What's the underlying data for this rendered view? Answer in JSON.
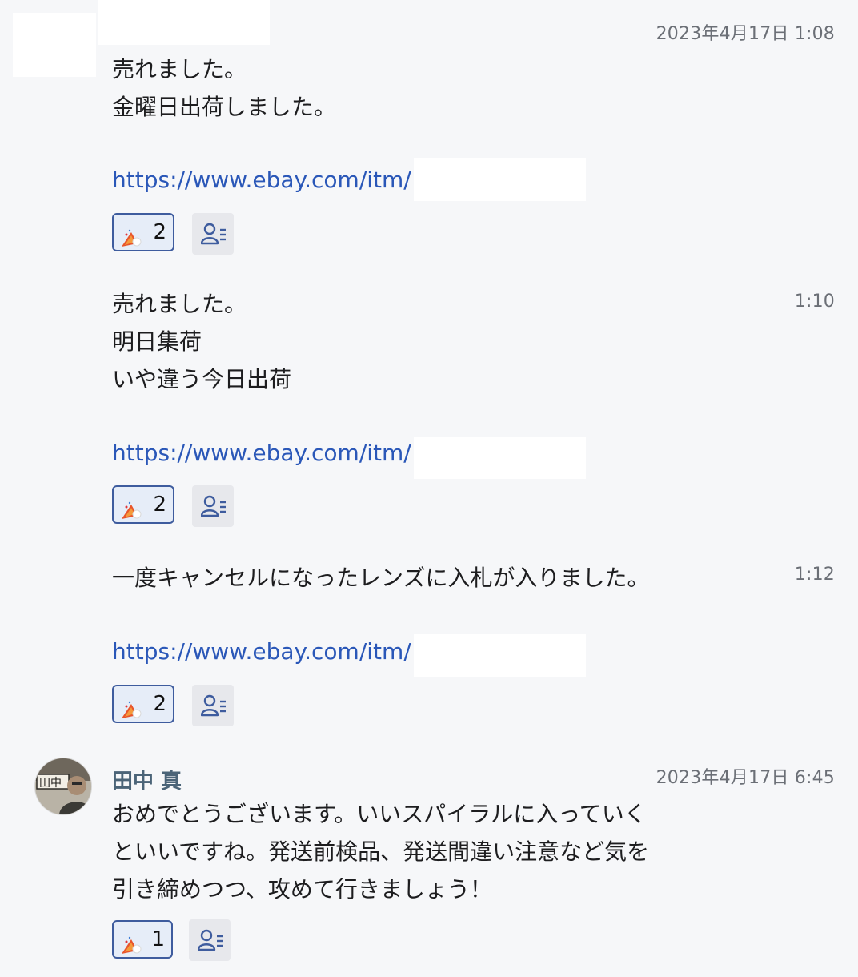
{
  "messages": [
    {
      "timestamp": "2023年4月17日 1:08",
      "lines": [
        "売れました。",
        "金曜日出荷しました。"
      ],
      "link": "https://www.ebay.com/itm/",
      "reaction_count": "2"
    },
    {
      "timestamp": "1:10",
      "lines": [
        "売れました。",
        "明日集荷",
        "いや違う今日出荷"
      ],
      "link": "https://www.ebay.com/itm/",
      "reaction_count": "2"
    },
    {
      "timestamp": "1:12",
      "lines": [
        "一度キャンセルになったレンズに入札が入りました。"
      ],
      "link": "https://www.ebay.com/itm/",
      "reaction_count": "2"
    },
    {
      "sender": "田中 真",
      "avatar_label": "田中",
      "timestamp": "2023年4月17日 6:45",
      "lines": [
        "おめでとうございます。いいスパイラルに入っていく",
        "といいですね。発送前検品、発送間違い注意など気を",
        "引き締めつつ、攻めて行きましょう！"
      ],
      "reaction_count": "1"
    }
  ],
  "icons": {
    "reaction": "party-popper-icon",
    "readers": "read-receipt-users-icon"
  },
  "colors": {
    "background": "#f6f7f9",
    "link": "#2a57b8",
    "reaction_border": "#3e5c9e",
    "reaction_bg": "#e6edf8",
    "readers_bg": "#e7e8ec",
    "sender_name": "#4b6478",
    "timestamp": "#6b6f76"
  }
}
